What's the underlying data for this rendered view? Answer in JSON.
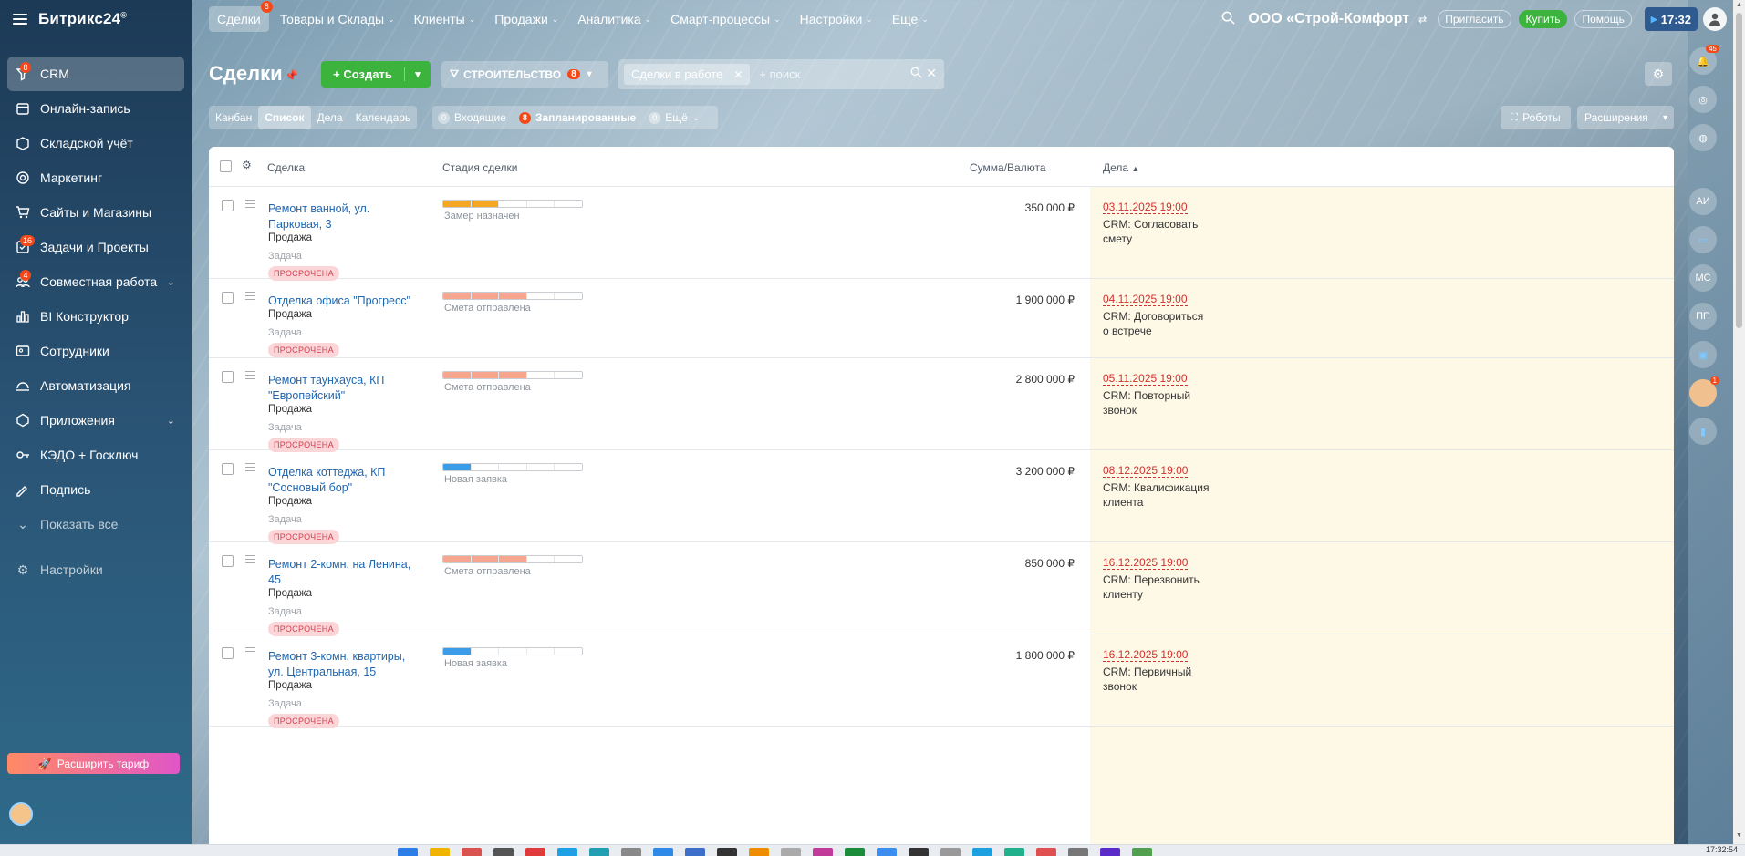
{
  "app": {
    "logo": "Битрикс24",
    "logo_mark": "©"
  },
  "sidebar": {
    "items": [
      {
        "label": "CRM",
        "badge": "8",
        "icon": "filter-icon",
        "active": true
      },
      {
        "label": "Онлайн-запись",
        "icon": "calendar-icon"
      },
      {
        "label": "Складской учёт",
        "icon": "box-icon"
      },
      {
        "label": "Маркетинг",
        "icon": "target-icon"
      },
      {
        "label": "Сайты и Магазины",
        "icon": "cart-icon"
      },
      {
        "label": "Задачи и Проекты",
        "badge": "16",
        "icon": "tasks-icon"
      },
      {
        "label": "Совместная работа",
        "badge": "4",
        "icon": "collab-icon",
        "expandable": true
      },
      {
        "label": "BI Конструктор",
        "icon": "bar-chart-icon"
      },
      {
        "label": "Сотрудники",
        "icon": "employees-icon"
      },
      {
        "label": "Автоматизация",
        "icon": "automation-icon"
      },
      {
        "label": "Приложения",
        "icon": "apps-icon",
        "expandable": true
      },
      {
        "label": "КЭДО + Госключ",
        "icon": "key-icon"
      },
      {
        "label": "Подпись",
        "icon": "signature-icon"
      }
    ],
    "show_all": "Показать все",
    "settings": "Настройки",
    "upgrade": "Расширить тариф"
  },
  "topnav": {
    "tabs": [
      {
        "label": "Сделки",
        "badge": "8",
        "active": true
      },
      {
        "label": "Товары и Склады",
        "caret": true
      },
      {
        "label": "Клиенты",
        "caret": true
      },
      {
        "label": "Продажи",
        "caret": true
      },
      {
        "label": "Аналитика",
        "caret": true
      },
      {
        "label": "Смарт-процессы",
        "caret": true
      },
      {
        "label": "Настройки",
        "caret": true
      },
      {
        "label": "Еще",
        "caret": true
      }
    ],
    "company": "ООО «Строй-Комфорт",
    "invite": "Пригласить",
    "buy": "Купить",
    "help": "Помощь",
    "time": "17:32"
  },
  "page": {
    "title": "Сделки",
    "create_label": "Создать",
    "pipeline_label": "СТРОИТЕЛЬСТВО",
    "pipeline_count": "8",
    "filter_chip": "Сделки в работе",
    "search_placeholder": "+ поиск"
  },
  "views": [
    "Канбан",
    "Список",
    "Дела",
    "Календарь"
  ],
  "active_view": "Список",
  "counters": [
    {
      "count": "0",
      "label": "Входящие",
      "red": false
    },
    {
      "count": "8",
      "label": "Запланированные",
      "red": true
    },
    {
      "count": "0",
      "label": "Ещё",
      "red": false
    }
  ],
  "toolbar_right": {
    "robots": "Роботы",
    "extensions": "Расширения"
  },
  "table": {
    "columns": {
      "deal": "Сделка",
      "stage": "Стадия сделки",
      "sum": "Сумма/Валюта",
      "activities": "Дела"
    },
    "rows": [
      {
        "name": "Ремонт ванной, ул. Парковая, 3",
        "type": "Продажа",
        "task_label": "Задача",
        "status": "ПРОСРОЧЕНА",
        "stage": "Замер назначен",
        "stage_color": "#f5a623",
        "stage_filled": 2,
        "sum": "350 000 ₽",
        "act_date": "03.11.2025 19:00",
        "act_text": "CRM: Согласовать смету"
      },
      {
        "name": "Отделка офиса \"Прогресс\"",
        "type": "Продажа",
        "task_label": "Задача",
        "status": "ПРОСРОЧЕНА",
        "stage": "Смета отправлена",
        "stage_color": "#f6a58f",
        "stage_filled": 3,
        "sum": "1 900 000 ₽",
        "act_date": "04.11.2025 19:00",
        "act_text": "CRM: Договориться о встрече"
      },
      {
        "name": "Ремонт таунхауса, КП \"Европейский\"",
        "type": "Продажа",
        "task_label": "Задача",
        "status": "ПРОСРОЧЕНА",
        "stage": "Смета отправлена",
        "stage_color": "#f6a58f",
        "stage_filled": 3,
        "sum": "2 800 000 ₽",
        "act_date": "05.11.2025 19:00",
        "act_text": "CRM: Повторный звонок"
      },
      {
        "name": "Отделка коттеджа, КП \"Сосновый бор\"",
        "type": "Продажа",
        "task_label": "Задача",
        "status": "ПРОСРОЧЕНА",
        "stage": "Новая заявка",
        "stage_color": "#3b9de8",
        "stage_filled": 1,
        "sum": "3 200 000 ₽",
        "act_date": "08.12.2025 19:00",
        "act_text": "CRM: Квалификация клиента"
      },
      {
        "name": "Ремонт 2-комн. на Ленина, 45",
        "type": "Продажа",
        "task_label": "Задача",
        "status": "ПРОСРОЧЕНА",
        "stage": "Смета отправлена",
        "stage_color": "#f6a58f",
        "stage_filled": 3,
        "sum": "850 000 ₽",
        "act_date": "16.12.2025 19:00",
        "act_text": "CRM: Перезвонить клиенту"
      },
      {
        "name": "Ремонт 3-комн. квартиры, ул. Центральная, 15",
        "type": "Продажа",
        "task_label": "Задача",
        "status": "ПРОСРОЧЕНА",
        "stage": "Новая заявка",
        "stage_color": "#3b9de8",
        "stage_filled": 1,
        "sum": "1 800 000 ₽",
        "act_date": "16.12.2025 19:00",
        "act_text": "CRM: Первичный звонок"
      }
    ]
  },
  "rail": {
    "notifications_badge": "45",
    "items": [
      "АИ",
      "МС",
      "ПП"
    ],
    "avatar_badge": "1"
  },
  "taskbar": {
    "time": "17:32:54"
  }
}
